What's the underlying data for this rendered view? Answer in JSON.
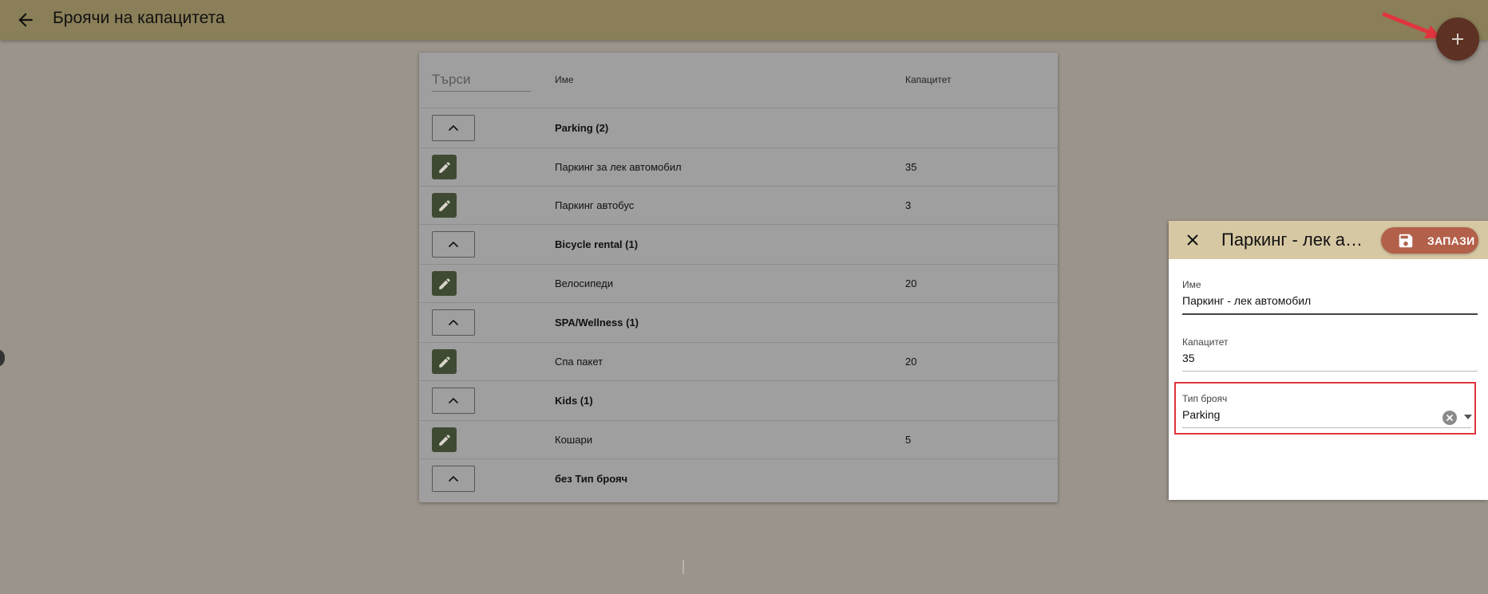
{
  "header": {
    "title": "Броячи на капацитета",
    "back_icon": "arrow-left-icon",
    "add_icon": "plus-icon"
  },
  "table": {
    "search_placeholder": "Търси",
    "columns": {
      "name": "Име",
      "capacity": "Капацитет"
    },
    "rows": [
      {
        "type": "group",
        "name": "Parking (2)"
      },
      {
        "type": "item",
        "name": "Паркинг за лек автомобил",
        "capacity": "35"
      },
      {
        "type": "item",
        "name": "Паркинг автобус",
        "capacity": "3"
      },
      {
        "type": "group",
        "name": "Bicycle rental (1)"
      },
      {
        "type": "item",
        "name": "Велосипеди",
        "capacity": "20"
      },
      {
        "type": "group",
        "name": "SPA/Wellness (1)"
      },
      {
        "type": "item",
        "name": "Спа пакет",
        "capacity": "20"
      },
      {
        "type": "group",
        "name": "Kids (1)"
      },
      {
        "type": "item",
        "name": "Кошари",
        "capacity": "5"
      },
      {
        "type": "group",
        "name": "без Тип брояч"
      }
    ]
  },
  "panel": {
    "title": "Паркинг - лек автомобил",
    "save_label": "ЗАПАЗИ",
    "fields": {
      "name": {
        "label": "Име",
        "value": "Паркинг - лек автомобил"
      },
      "capacity": {
        "label": "Капацитет",
        "value": "35"
      },
      "counter_type": {
        "label": "Тип брояч",
        "value": "Parking"
      }
    }
  },
  "colors": {
    "topbar": "#8a7f58",
    "overlay_background": "#9b948b",
    "fab": "#5d3123",
    "edit_button": "#3f4a33",
    "save_button": "#b3604a",
    "panel_header": "#d7c8a4",
    "highlight": "#e0353f"
  }
}
